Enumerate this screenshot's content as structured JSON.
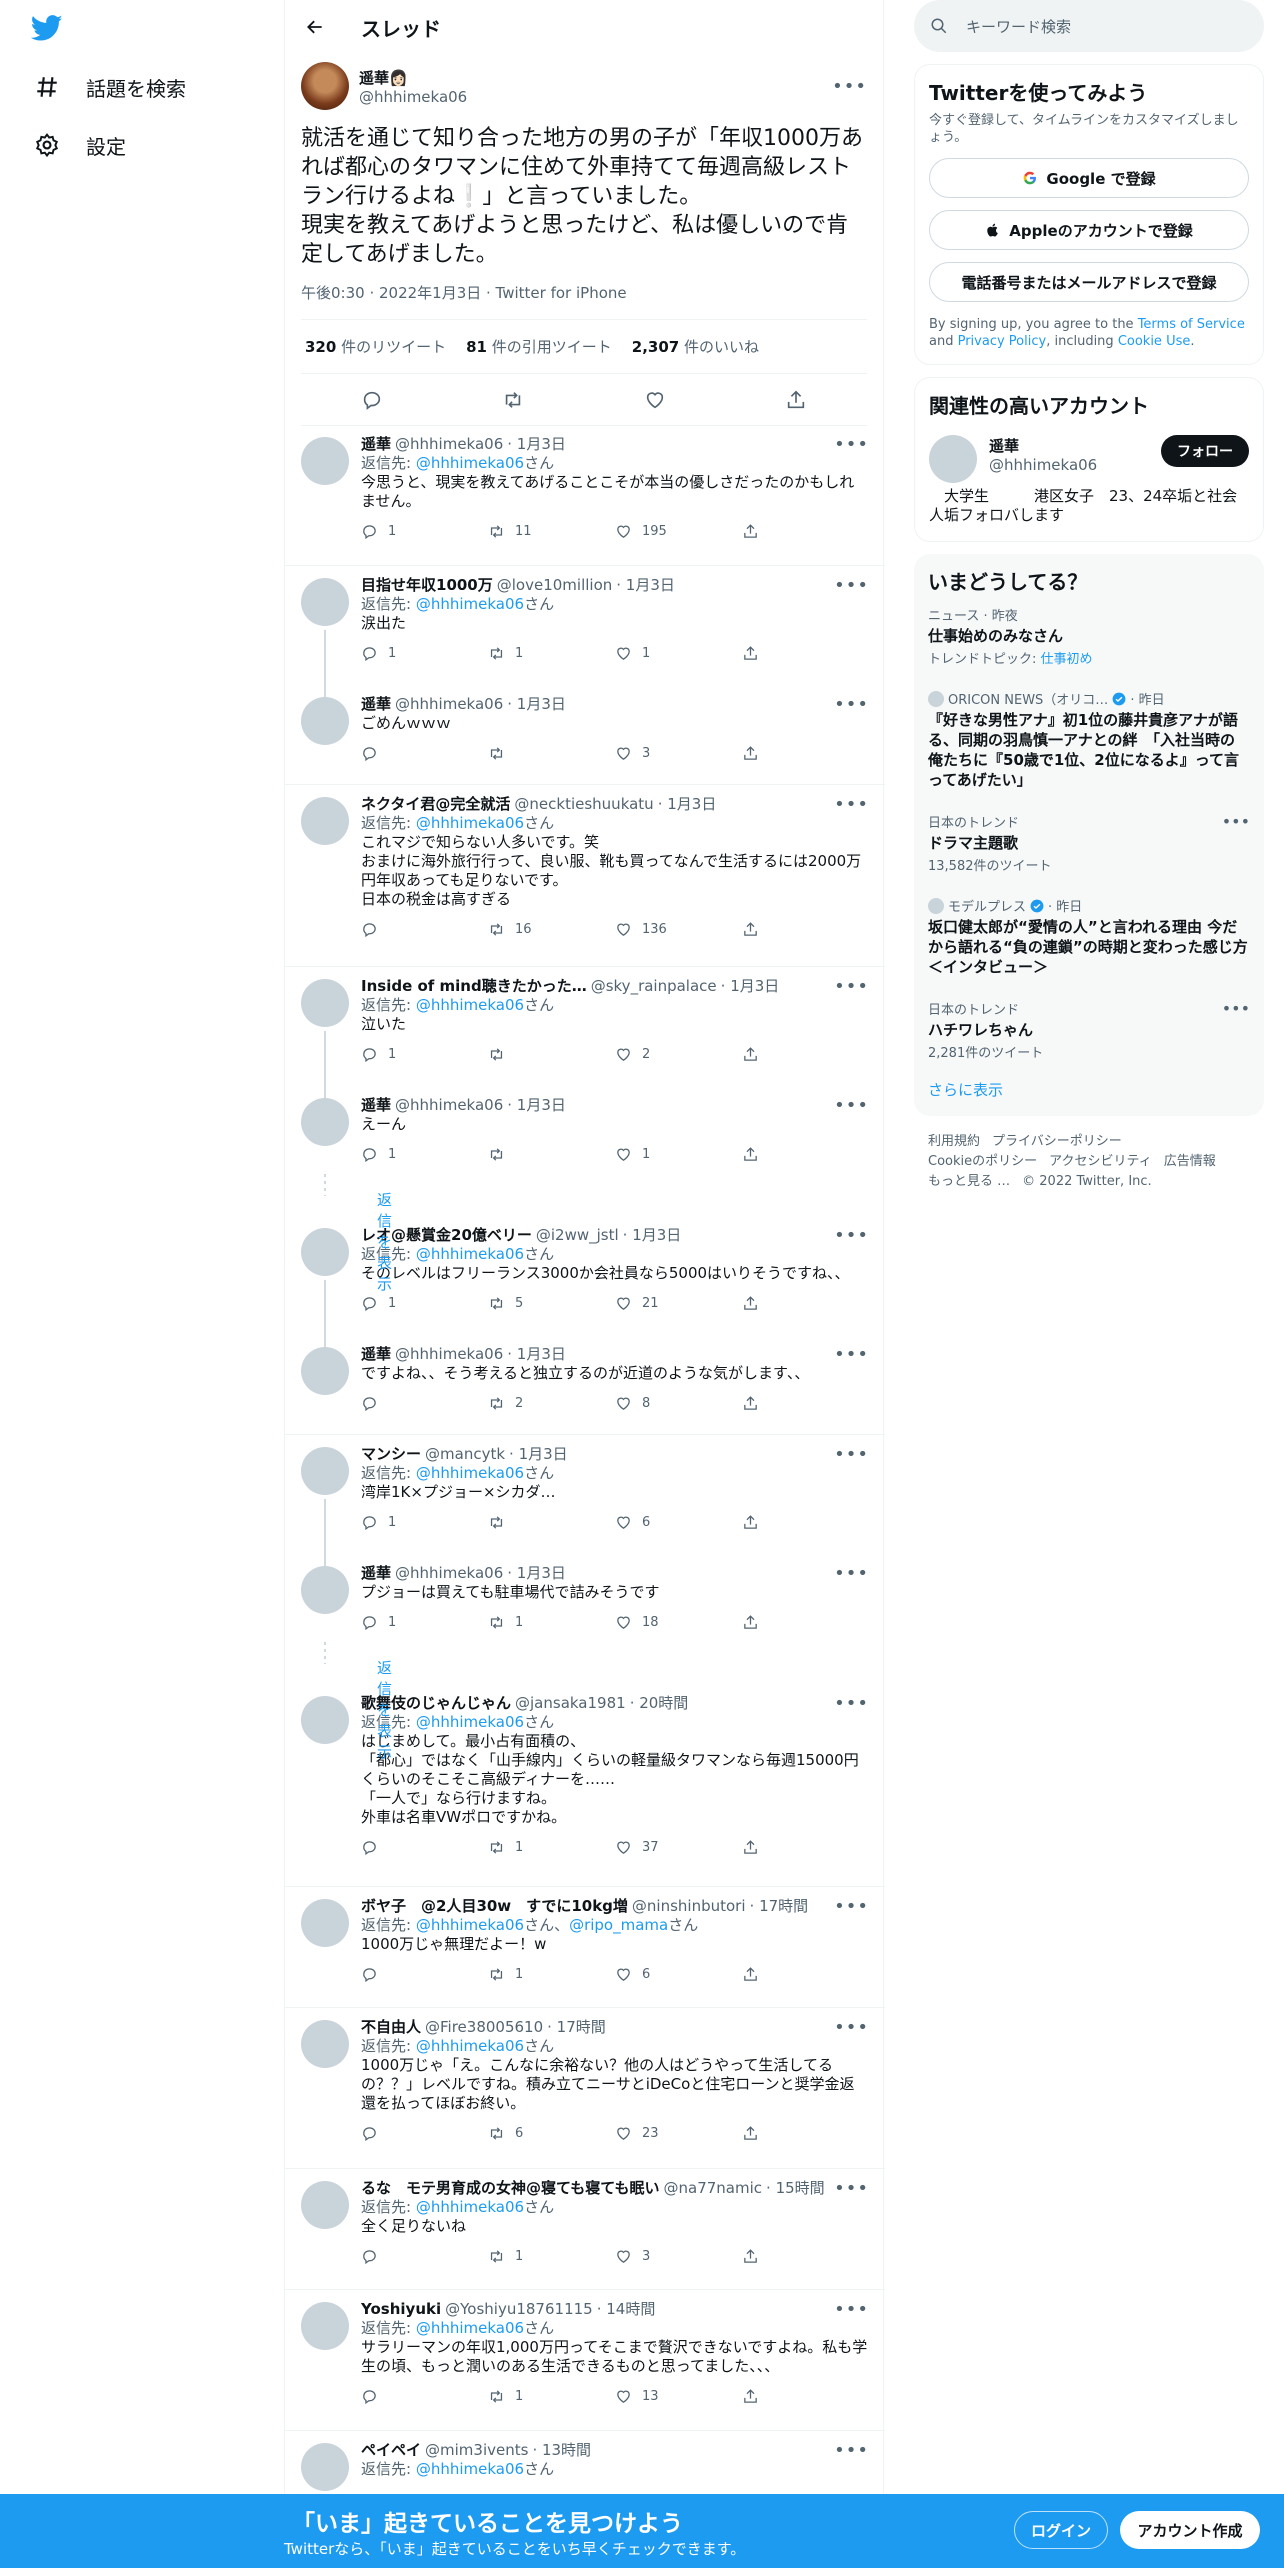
{
  "nav": {
    "explore_label": "話題を検索",
    "settings_label": "設定"
  },
  "header": {
    "title": "スレッド"
  },
  "focal": {
    "display_name": "遥華👩🏻",
    "handle": "@hhhimeka06",
    "text": "就活を通じて知り合った地方の男の子が「年収1000万あれば都心のタワマンに住めて外車持てて毎週高級レストラン行けるよね❕」と言っていました。\n現実を教えてあげようと思ったけど、私は優しいので肯定してあげました。",
    "meta": "午後0:30 · 2022年1月3日 · Twitter for iPhone",
    "retweets": "320",
    "retweets_label": "件のリツイート",
    "quotes": "81",
    "quotes_label": "件の引用ツイート",
    "likes": "2,307",
    "likes_label": "件のいいね"
  },
  "replies": [
    {
      "name": "遥華",
      "handle": "@hhhimeka06",
      "time": "· 1月3日",
      "replyto": "返信先: ",
      "replyto_handle": "@hhhimeka06",
      "replyto_suffix": "さん",
      "text": "今思うと、現実を教えてあげることこそが本当の優しさだったのかもしれません。",
      "replies": "1",
      "retweets": "11",
      "likes": "195"
    },
    {
      "name": "目指せ年収1000万",
      "handle": "@love10million",
      "time": "· 1月3日",
      "replyto": "返信先: ",
      "replyto_handle": "@hhhimeka06",
      "replyto_suffix": "さん",
      "text": "涙出た",
      "replies": "1",
      "retweets": "1",
      "likes": "1"
    },
    {
      "name": "遥華",
      "handle": "@hhhimeka06",
      "time": "· 1月3日",
      "text": "ごめんｗｗｗ",
      "replies": "",
      "retweets": "",
      "likes": "3"
    },
    {
      "name": "ネクタイ君@完全就活",
      "handle": "@necktieshuukatu",
      "time": "· 1月3日",
      "replyto": "返信先: ",
      "replyto_handle": "@hhhimeka06",
      "replyto_suffix": "さん",
      "text": "これマジで知らない人多いです。笑\nおまけに海外旅行行って、良い服、靴も買ってなんで生活するには2000万円年収あっても足りないです。\n日本の税金は高すぎる",
      "replies": "",
      "retweets": "16",
      "likes": "136"
    },
    {
      "name": "Inside of mind聴きたかった…",
      "handle": "@sky_rainpalace",
      "time": "· 1月3日",
      "replyto": "返信先: ",
      "replyto_handle": "@hhhimeka06",
      "replyto_suffix": "さん",
      "text": "泣いた",
      "replies": "1",
      "retweets": "",
      "likes": "2"
    },
    {
      "name": "遥華",
      "handle": "@hhhimeka06",
      "time": "· 1月3日",
      "text": "えーん",
      "replies": "1",
      "retweets": "",
      "likes": "1"
    },
    {
      "name": "レオ@懸賞金20億ベリー",
      "handle": "@i2ww_jstl",
      "time": "· 1月3日",
      "replyto": "返信先: ",
      "replyto_handle": "@hhhimeka06",
      "replyto_suffix": "さん",
      "text": "そのレベルはフリーランス3000か会社員なら5000はいりそうですね、、",
      "replies": "1",
      "retweets": "5",
      "likes": "21"
    },
    {
      "name": "遥華",
      "handle": "@hhhimeka06",
      "time": "· 1月3日",
      "text": "ですよね、、そう考えると独立するのが近道のような気がします、、",
      "replies": "",
      "retweets": "2",
      "likes": "8"
    },
    {
      "name": "マンシー",
      "handle": "@mancytk",
      "time": "· 1月3日",
      "replyto": "返信先: ",
      "replyto_handle": "@hhhimeka06",
      "replyto_suffix": "さん",
      "text": "湾岸1K×プジョー×シカダ…",
      "replies": "1",
      "retweets": "",
      "likes": "6"
    },
    {
      "name": "遥華",
      "handle": "@hhhimeka06",
      "time": "· 1月3日",
      "text": "プジョーは買えても駐車場代で詰みそうです",
      "replies": "1",
      "retweets": "1",
      "likes": "18"
    },
    {
      "name": "歌舞伎のじゃんじゃん",
      "handle": "@jansaka1981",
      "time": "· 20時間",
      "replyto": "返信先: ",
      "replyto_handle": "@hhhimeka06",
      "replyto_suffix": "さん",
      "text": "はじまめして。最小占有面積の、\n「都心」ではなく「山手線内」くらいの軽量級タワマンなら毎週15000円くらいのそこそこ高級ディナーを……\n「一人で」なら行けますね。\n外車は名車VWポロですかね。",
      "replies": "",
      "retweets": "1",
      "likes": "37"
    },
    {
      "name": "ボヤ子　@2人目30w　すでに10kg増",
      "handle": "@ninshinbutori",
      "time": "· 17時間",
      "replyto": "返信先: ",
      "replyto_handle": "@hhhimeka06",
      "replyto_suffix": "さん、",
      "replyto_handle2": "@ripo_mama",
      "replyto_suffix2": "さん",
      "text": "1000万じゃ無理だよー！w",
      "replies": "",
      "retweets": "1",
      "likes": "6"
    },
    {
      "name": "不自由人",
      "handle": "@Fire38005610",
      "time": "· 17時間",
      "replyto": "返信先: ",
      "replyto_handle": "@hhhimeka06",
      "replyto_suffix": "さん",
      "text": "1000万じゃ「え。こんなに余裕ない？他の人はどうやって生活してるの？？」レベルですね。積み立てニーサとiDeCoと住宅ローンと奨学金返還を払ってほぼお終い。",
      "replies": "",
      "retweets": "6",
      "likes": "23"
    },
    {
      "name": "るな　モテ男育成の女神@寝ても寝ても眠い",
      "handle": "@na77namic",
      "time": "· 15時間",
      "replyto": "返信先: ",
      "replyto_handle": "@hhhimeka06",
      "replyto_suffix": "さん",
      "text": "全く足りないね",
      "replies": "",
      "retweets": "1",
      "likes": "3"
    },
    {
      "name": "Yoshiyuki",
      "handle": "@Yoshiyu18761115",
      "time": "· 14時間",
      "replyto": "返信先: ",
      "replyto_handle": "@hhhimeka06",
      "replyto_suffix": "さん",
      "text": "サラリーマンの年収1,000万円ってそこまで贅沢できないですよね。私も学生の頃、もっと潤いのある生活できるものと思ってました、、、",
      "replies": "",
      "retweets": "1",
      "likes": "13"
    },
    {
      "name": "ペイペイ",
      "handle": "@mim3ivents",
      "time": "· 13時間",
      "replyto": "返信先: ",
      "replyto_handle": "@hhhimeka06",
      "replyto_suffix": "さん",
      "text": "",
      "replies": "",
      "retweets": "",
      "likes": ""
    }
  ],
  "show_replies_label": "返信を表示",
  "right": {
    "search_placeholder": "キーワード検索",
    "signup": {
      "title": "Twitterを使ってみよう",
      "subtitle": "今すぐ登録して、タイムラインをカスタマイズしましょう。",
      "google": "Google で登録",
      "apple": "Appleのアカウントで登録",
      "phone": "電話番号またはメールアドレスで登録",
      "terms_a": "By signing up, you agree to the ",
      "terms_link": "Terms of Service",
      "terms_b": " and ",
      "privacy_link": "Privacy Policy",
      "terms_c": ", including ",
      "cookie_link": "Cookie Use",
      "terms_d": "."
    },
    "relevant": {
      "title": "関連性の高いアカウント",
      "name": "遥華",
      "handle": "@hhhimeka06",
      "follow": "フォロー",
      "bio": "　大学生　　　港区女子　23、24卒垢と社会人垢フォロバします"
    },
    "trends": {
      "title": "いまどうしてる？",
      "items": [
        {
          "context": "ニュース · 昨夜",
          "title": "仕事始めのみなさん",
          "sub_prefix": "トレンドトピック: ",
          "sub_link": "仕事初め"
        },
        {
          "context": "ORICON NEWS（オリコ…",
          "context_time": "· 昨日",
          "title": "『好きな男性アナ』初1位の藤井貴彦アナが語る、同期の羽鳥慎一アナとの絆　「入社当時の俺たちに『50歳で1位、2位になるよ』って言ってあげたい」"
        },
        {
          "context": "日本のトレンド",
          "title": "ドラマ主題歌",
          "sub": "13,582件のツイート"
        },
        {
          "context": "モデルプレス",
          "context_time": "· 昨日",
          "title": "坂口健太郎が“愛情の人”と言われる理由 今だから語れる“負の連鎖”の時期と変わった感じ方＜インタビュー＞"
        },
        {
          "context": "日本のトレンド",
          "title": "ハチワレちゃん",
          "sub": "2,281件のツイート"
        }
      ],
      "show_more": "さらに表示"
    },
    "footer": [
      "利用規約",
      "プライバシーポリシー",
      "Cookieのポリシー",
      "アクセシビリティ",
      "広告情報",
      "もっと見る …",
      "© 2022 Twitter, Inc."
    ]
  },
  "bottom_bar": {
    "title": "「いま」起きていることを見つけよう",
    "subtitle": "Twitterなら、「いま」起きていることをいち早くチェックできます。",
    "login": "ログイン",
    "signup": "アカウント作成"
  },
  "colors": {
    "accent": "#1d9bf0",
    "text": "#0f1419",
    "muted": "#536471"
  }
}
